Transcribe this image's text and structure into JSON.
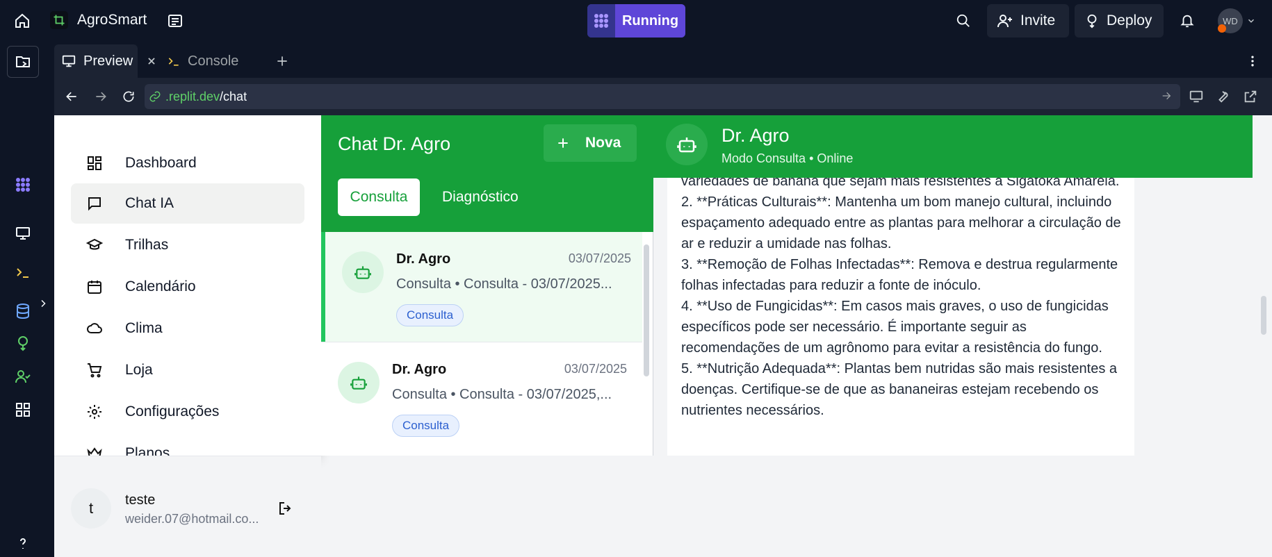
{
  "app": {
    "name": "AgroSmart",
    "status": "Running"
  },
  "topbar": {
    "invite_label": "Invite",
    "deploy_label": "Deploy",
    "avatar_initials": "WD"
  },
  "tabs": [
    {
      "label": "Preview"
    },
    {
      "label": "Console"
    }
  ],
  "url": {
    "domain": ".replit.dev",
    "path": "/chat"
  },
  "sidebar": {
    "items": [
      {
        "label": "Dashboard",
        "icon": "dashboard-icon"
      },
      {
        "label": "Chat IA",
        "icon": "chat-icon",
        "active": true
      },
      {
        "label": "Trilhas",
        "icon": "graduation-cap-icon"
      },
      {
        "label": "Calendário",
        "icon": "calendar-icon"
      },
      {
        "label": "Clima",
        "icon": "cloud-icon"
      },
      {
        "label": "Loja",
        "icon": "cart-icon"
      },
      {
        "label": "Configurações",
        "icon": "gear-icon"
      },
      {
        "label": "Planos",
        "icon": "crown-icon"
      }
    ],
    "user": {
      "initial": "t",
      "name": "teste",
      "email": "weider.07@hotmail.co..."
    }
  },
  "chatlist": {
    "title": "Chat Dr. Agro",
    "new_label": "Nova",
    "tabs": [
      "Consulta",
      "Diagnóstico"
    ],
    "items": [
      {
        "name": "Dr. Agro",
        "date": "03/07/2025",
        "subtitle": "Consulta • Consulta - 03/07/2025...",
        "badge": "Consulta",
        "selected": true
      },
      {
        "name": "Dr. Agro",
        "date": "03/07/2025",
        "subtitle": "Consulta • Consulta - 03/07/2025,...",
        "badge": "Consulta",
        "selected": false
      }
    ]
  },
  "conversation": {
    "name": "Dr. Agro",
    "status": "Modo Consulta • Online",
    "message": "variedades de banana que sejam mais resistentes à Sigatoka Amarela.\n2. **Práticas Culturais**: Mantenha um bom manejo cultural, incluindo espaçamento adequado entre as plantas para melhorar a circulação de ar e reduzir a umidade nas folhas.\n3. **Remoção de Folhas Infectadas**: Remova e destrua regularmente folhas infectadas para reduzir a fonte de inóculo.\n4. **Uso de Fungicidas**: Em casos mais graves, o uso de fungicidas específicos pode ser necessário. É importante seguir as recomendações de um agrônomo para evitar a resistência do fungo.\n5. **Nutrição Adequada**: Plantas bem nutridas são mais resistentes a doenças. Certifique-se de que as bananeiras estejam recebendo os nutrientes necessários."
  },
  "colors": {
    "brand_green": "#16a03a",
    "running_purple": "#5e46d8",
    "ide_bg": "#0e1525"
  }
}
